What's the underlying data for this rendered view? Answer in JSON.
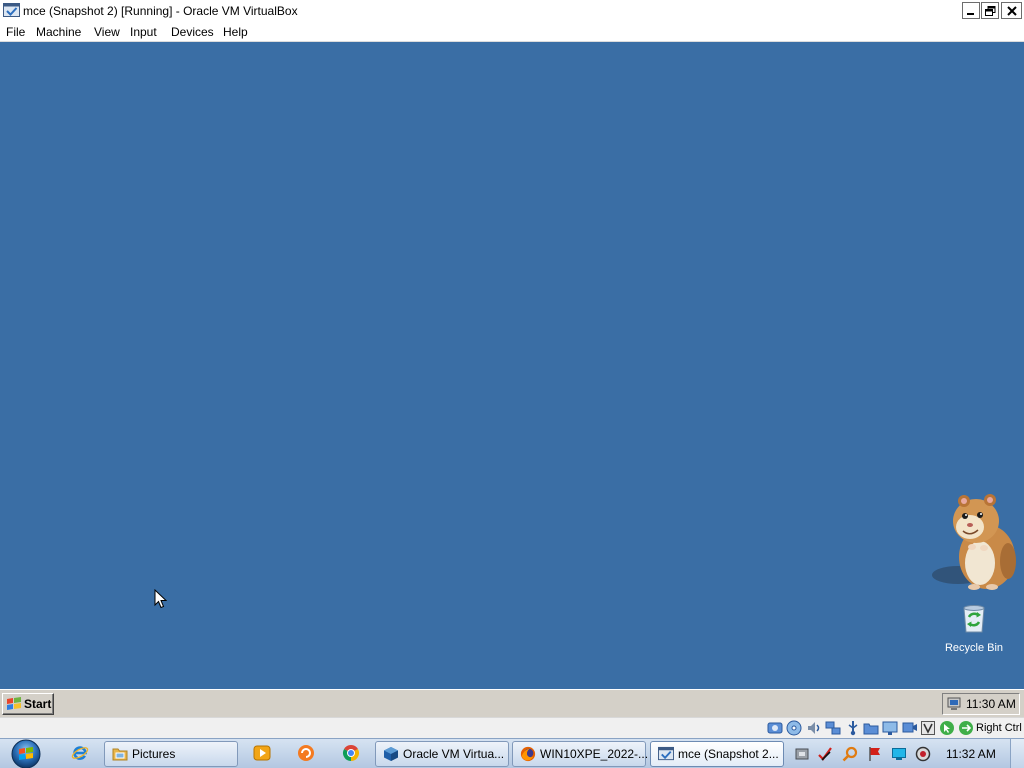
{
  "window": {
    "title": "mce (Snapshot 2) [Running] - Oracle VM VirtualBox",
    "icon": "virtualbox-vm-icon",
    "controls": [
      "minimize-icon",
      "restore-icon",
      "close-icon"
    ]
  },
  "menu": {
    "items": [
      {
        "label": "File"
      },
      {
        "label": "Machine"
      },
      {
        "label": "View"
      },
      {
        "label": "Input"
      },
      {
        "label": "Devices"
      },
      {
        "label": "Help"
      }
    ]
  },
  "guest": {
    "desktop_color": "#3a6ea5",
    "pet_icon": "hamster-character-icon",
    "cursor_icon": "arrow-cursor-icon",
    "desktop_items": [
      {
        "label": "Recycle Bin",
        "icon": "recycle-bin-icon"
      }
    ],
    "taskbar": {
      "start_icon": "windows-flag-icon",
      "start_label": "Start",
      "tray_icon": "network-tray-icon",
      "clock": "11:30 AM"
    }
  },
  "vbox_status": {
    "indicators": [
      "hard-disk-icon",
      "optical-drive-icon",
      "audio-icon",
      "network-icon",
      "usb-icon",
      "shared-folders-icon",
      "display-icon",
      "recording-icon",
      "virtualization-icon",
      "mouse-integration-icon",
      "keyboard-capture-icon"
    ],
    "host_key": "Right Ctrl"
  },
  "host_taskbar": {
    "start_icon": "windows-orb-icon",
    "items": [
      {
        "icon": "internet-explorer-icon"
      },
      {
        "icon": "explorer-folder-icon",
        "label": "Pictures"
      },
      {
        "icon": "media-player-icon"
      },
      {
        "icon": "orange-app-icon"
      },
      {
        "icon": "chrome-icon"
      },
      {
        "icon": "virtualbox-icon",
        "label": "Oracle VM Virtua..."
      },
      {
        "icon": "firefox-icon",
        "label": "WIN10XPE_2022-..."
      },
      {
        "icon": "virtualbox-vm-icon",
        "label": "mce (Snapshot 2...",
        "active": true
      }
    ],
    "tray_icons": [
      "device-tray-icon",
      "pen-tray-icon",
      "search-tray-icon",
      "action-center-flag-icon",
      "monitor-tray-icon",
      "volume-tray-icon"
    ],
    "clock": "11:32 AM"
  }
}
